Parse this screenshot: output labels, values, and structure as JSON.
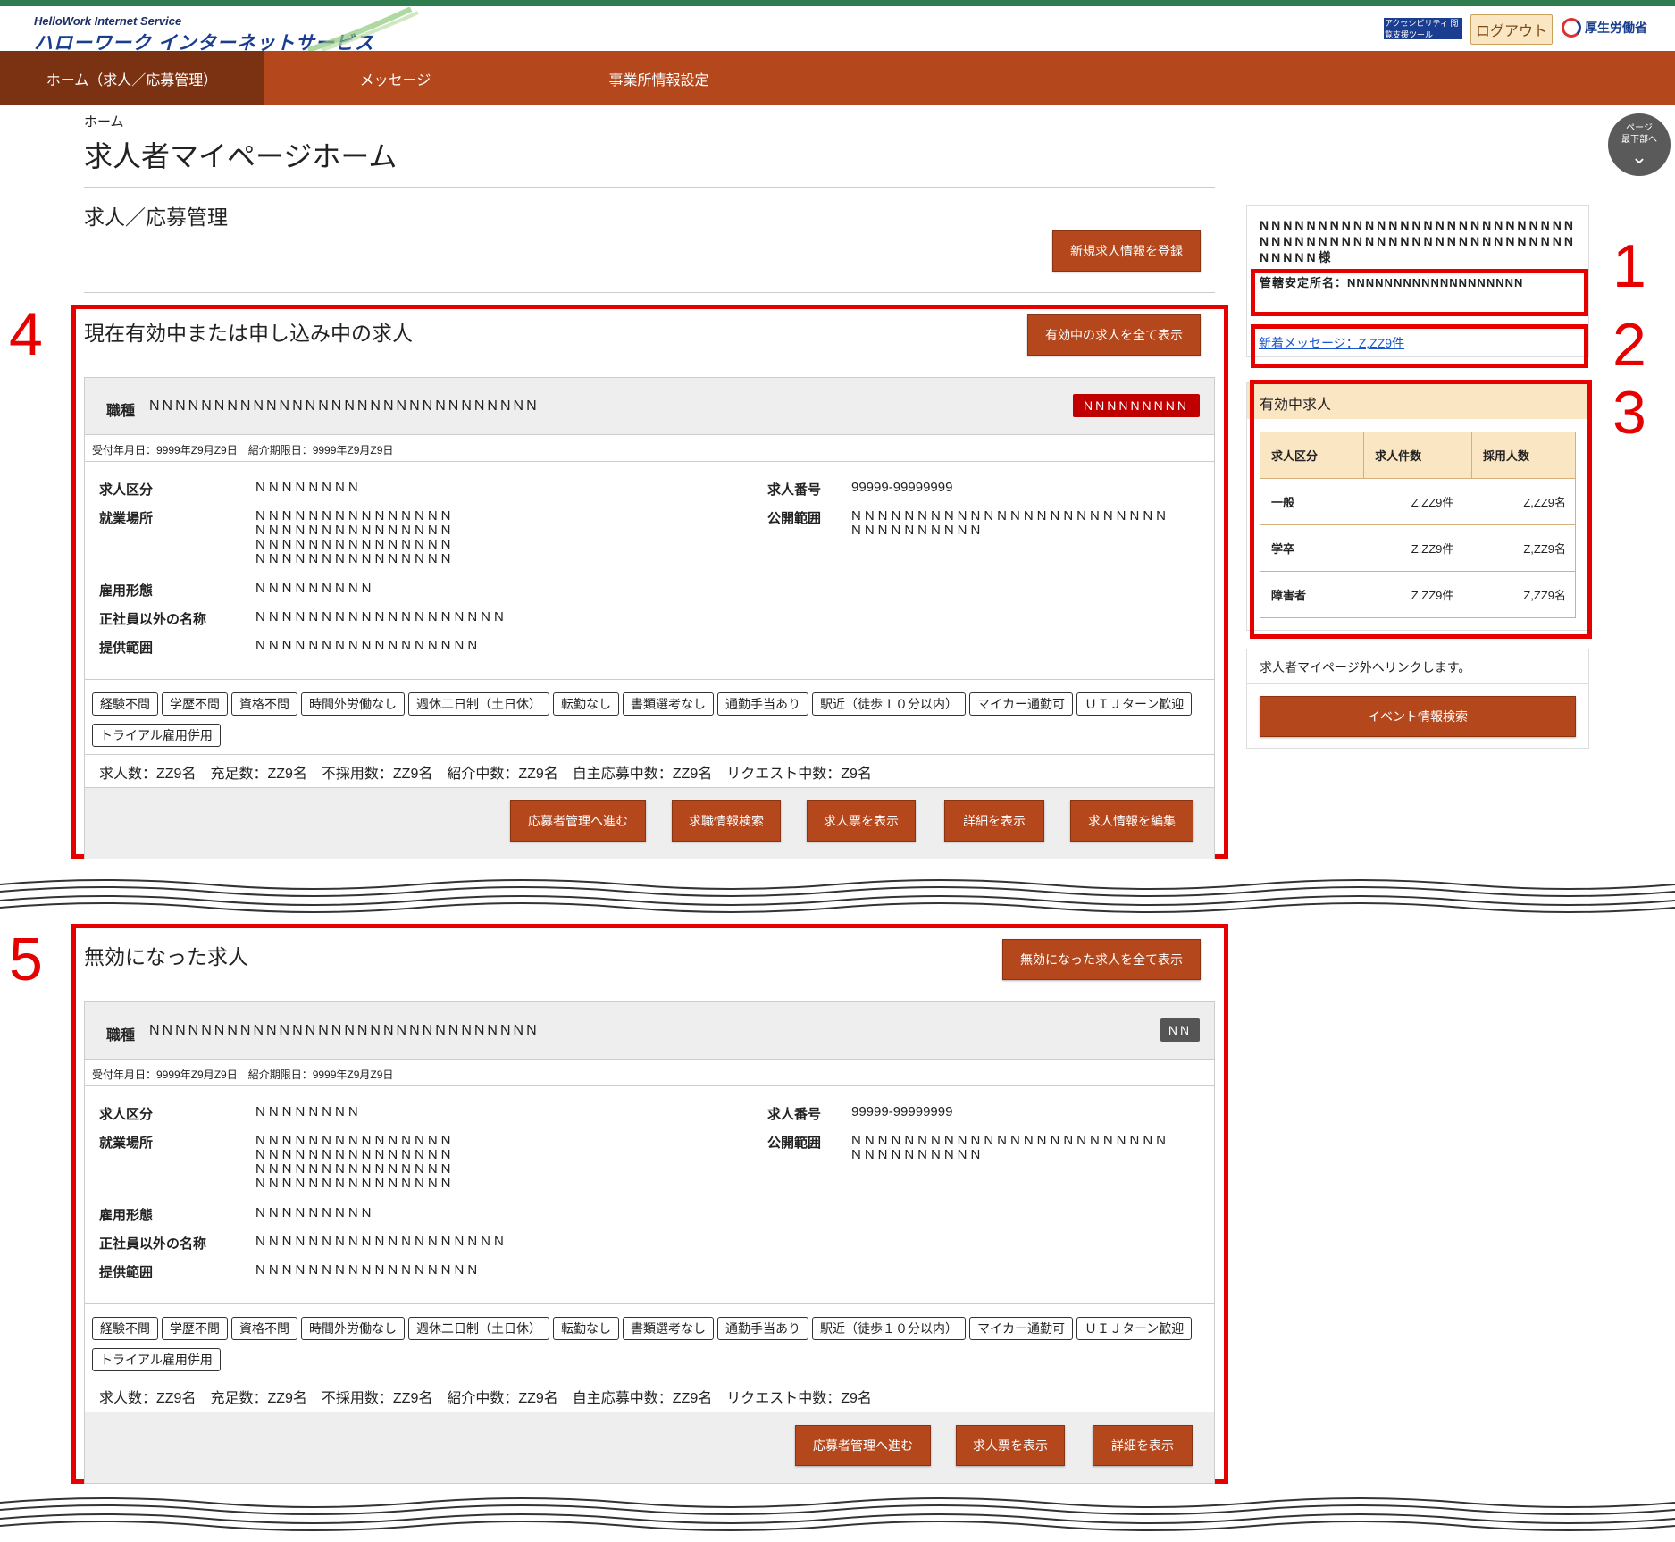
{
  "header": {
    "logo_sub": "HelloWork Internet Service",
    "logo_main": "ハローワーク インターネットサービス",
    "accessibility_label": "アクセシビリティ 閲覧支援ツール",
    "logout_label": "ログアウト",
    "ministry_label": "厚生労働省"
  },
  "nav": [
    {
      "label": "ホーム（求人／応募管理）"
    },
    {
      "label": "メッセージ"
    },
    {
      "label": "事業所情報設定"
    }
  ],
  "breadcrumb": "ホーム",
  "page_title": "求人者マイページホーム",
  "section_title": "求人／応募管理",
  "new_job_button": "新規求人情報を登録",
  "scroll_button": {
    "line1": "ページ",
    "line2": "最下部へ"
  },
  "annotations": [
    "1",
    "2",
    "3",
    "4",
    "5"
  ],
  "sidebar": {
    "name": "NNNNNNNNNNNNNNNNNNNNNNNNNNNNNNNNNNNNNNNNNNNNNNNNNNNNNNNNNNN様",
    "office": "管轄安定所名：NNNNNNNNNNNNNNNNNNN",
    "message_link": "新着メッセージ：Z,ZZ9件",
    "table_title": "有効中求人",
    "table_headers": [
      "求人区分",
      "求人件数",
      "採用人数"
    ],
    "table_rows": [
      [
        "一般",
        "Z,ZZ9件",
        "Z,ZZ9名"
      ],
      [
        "学卒",
        "Z,ZZ9件",
        "Z,ZZ9名"
      ],
      [
        "障害者",
        "Z,ZZ9件",
        "Z,ZZ9名"
      ]
    ],
    "external_note": "求人者マイページ外へリンクします。",
    "event_button": "イベント情報検索"
  },
  "active_section": {
    "heading": "現在有効中または申し込み中の求人",
    "show_all_button": "有効中の求人を全て表示",
    "card": {
      "occupation_label": "職種",
      "occupation_value": "NNNNNNNNNNNNNNNNNNNNNNNNNNNNNN",
      "badge": "NNNNNNNNN",
      "dates": "受付年月日：9999年Z9月Z9日　紹介期限日：9999年Z9月Z9日",
      "fields": {
        "kubun_label": "求人区分",
        "kubun_value": "NNNNNNNN",
        "place_label": "就業場所",
        "place_value": "NNNNNNNNNNNNNNN\nNNNNNNNNNNNNNNN\nNNNNNNNNNNNNNNN\nNNNNNNNNNNNNNNN",
        "employ_label": "雇用形態",
        "employ_value": "NNNNNNNNN",
        "nonregular_label": "正社員以外の名称",
        "nonregular_value": "NNNNNNNNNNNNNNNNNNN",
        "scope_label": "提供範囲",
        "scope_value": "NNNNNNNNNNNNNNNNN",
        "number_label": "求人番号",
        "number_value": "99999-99999999",
        "public_label": "公開範囲",
        "public_value": "NNNNNNNNNNNNNNNNNNNNNNNN\nNNNNNNNNNN"
      },
      "tags": [
        "経験不問",
        "学歴不問",
        "資格不問",
        "時間外労働なし",
        "週休二日制（土日休）",
        "転勤なし",
        "書類選考なし",
        "通勤手当あり",
        "駅近（徒歩１０分以内）",
        "マイカー通勤可",
        "ＵＩＪターン歓迎",
        "トライアル雇用併用"
      ],
      "counts": "求人数：ZZ9名　充足数：ZZ9名　不採用数：ZZ9名　紹介中数：ZZ9名　自主応募中数：ZZ9名　リクエスト中数：Z9名",
      "actions": [
        "応募者管理へ進む",
        "求職情報検索",
        "求人票を表示",
        "詳細を表示",
        "求人情報を編集"
      ]
    }
  },
  "invalid_section": {
    "heading": "無効になった求人",
    "show_all_button": "無効になった求人を全て表示",
    "card": {
      "occupation_label": "職種",
      "occupation_value": "NNNNNNNNNNNNNNNNNNNNNNNNNNNNNN",
      "badge": "NN",
      "dates": "受付年月日：9999年Z9月Z9日　紹介期限日：9999年Z9月Z9日",
      "fields": {
        "kubun_label": "求人区分",
        "kubun_value": "NNNNNNNN",
        "place_label": "就業場所",
        "place_value": "NNNNNNNNNNNNNNN\nNNNNNNNNNNNNNNN\nNNNNNNNNNNNNNNN\nNNNNNNNNNNNNNNN",
        "employ_label": "雇用形態",
        "employ_value": "NNNNNNNNN",
        "nonregular_label": "正社員以外の名称",
        "nonregular_value": "NNNNNNNNNNNNNNNNNNN",
        "scope_label": "提供範囲",
        "scope_value": "NNNNNNNNNNNNNNNNN",
        "number_label": "求人番号",
        "number_value": "99999-99999999",
        "public_label": "公開範囲",
        "public_value": "NNNNNNNNNNNNNNNNNNNNNNNN\nNNNNNNNNNN"
      },
      "tags": [
        "経験不問",
        "学歴不問",
        "資格不問",
        "時間外労働なし",
        "週休二日制（土日休）",
        "転勤なし",
        "書類選考なし",
        "通勤手当あり",
        "駅近（徒歩１０分以内）",
        "マイカー通勤可",
        "ＵＩＪターン歓迎",
        "トライアル雇用併用"
      ],
      "counts": "求人数：ZZ9名　充足数：ZZ9名　不採用数：ZZ9名　紹介中数：ZZ9名　自主応募中数：ZZ9名　リクエスト中数：Z9名",
      "actions": [
        "応募者管理へ進む",
        "求人票を表示",
        "詳細を表示"
      ]
    }
  },
  "colors": {
    "brand": "#b5471c",
    "nav_active": "#7a3213",
    "annotation": "#e60000",
    "top_line": "#2e7d4f"
  }
}
